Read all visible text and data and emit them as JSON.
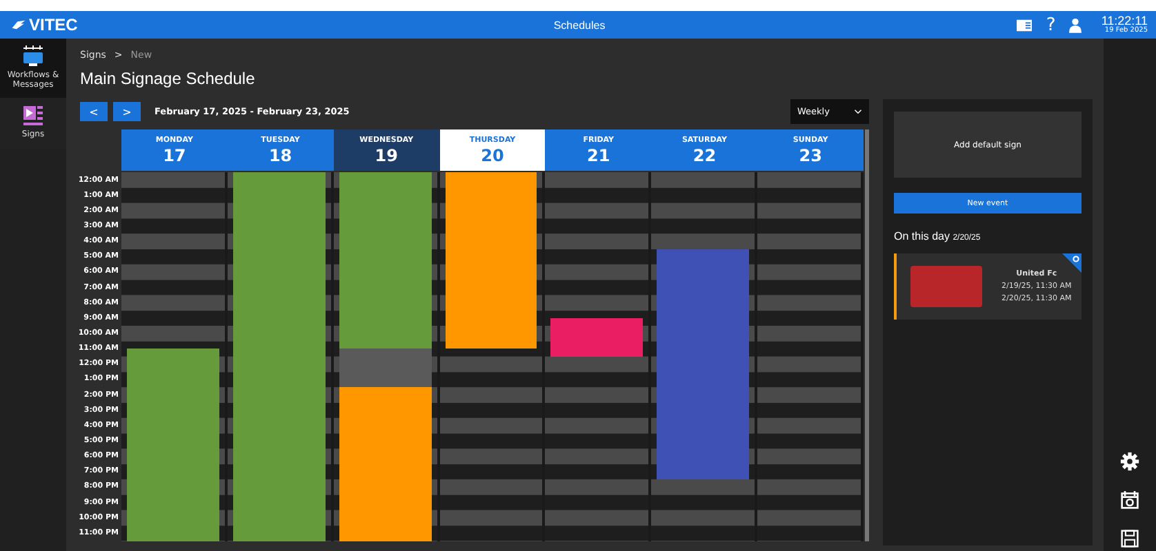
{
  "header": {
    "logo": "VITEC",
    "title": "Schedules",
    "time": "11:22:11",
    "date": "19 Feb 2025",
    "help": "?"
  },
  "nav": [
    {
      "label": "Workflows & Messages",
      "selected": true
    },
    {
      "label": "Signs",
      "selected": false
    }
  ],
  "breadcrumb": {
    "items": [
      "Signs",
      "New"
    ],
    "separator": ">"
  },
  "page_title": "Main Signage Schedule",
  "toolbar": {
    "prev": "<",
    "next": ">",
    "range": "February 17, 2025 - February 23, 2025",
    "view": "Weekly"
  },
  "hours": [
    "12:00 AM",
    "1:00 AM",
    "2:00 AM",
    "3:00 AM",
    "4:00 AM",
    "5:00 AM",
    "6:00 AM",
    "7:00 AM",
    "8:00 AM",
    "9:00 AM",
    "10:00 AM",
    "11:00 AM",
    "12:00 PM",
    "1:00 PM",
    "2:00 PM",
    "3:00 PM",
    "4:00 PM",
    "5:00 PM",
    "6:00 PM",
    "7:00 PM",
    "8:00 PM",
    "9:00 PM",
    "10:00 PM",
    "11:00 PM"
  ],
  "days": [
    {
      "name": "MONDAY",
      "date": "17",
      "selected": false,
      "today": false,
      "events": [
        {
          "color": "#659b3a"
        }
      ]
    },
    {
      "name": "TUESDAY",
      "date": "18",
      "selected": false,
      "today": false,
      "events": [
        {
          "color": "#659b3a"
        }
      ]
    },
    {
      "name": "WEDNESDAY",
      "date": "19",
      "selected": false,
      "today": true,
      "events": [
        {
          "color": "#659b3a"
        },
        {
          "color": "#5a5a5a"
        },
        {
          "color": "#ff9800"
        }
      ]
    },
    {
      "name": "THURSDAY",
      "date": "20",
      "selected": true,
      "today": false,
      "events": [
        {
          "color": "#ff9800"
        }
      ]
    },
    {
      "name": "FRIDAY",
      "date": "21",
      "selected": false,
      "today": false,
      "events": [
        {
          "color": "#e91e63"
        }
      ]
    },
    {
      "name": "SATURDAY",
      "date": "22",
      "selected": false,
      "today": false,
      "events": [
        {
          "color": "#3f51b5"
        }
      ]
    },
    {
      "name": "SUNDAY",
      "date": "23",
      "selected": false,
      "today": false
    }
  ],
  "side_panel": {
    "default_sign": "Add default sign",
    "new_event": "New event",
    "day_heading": "On this day",
    "day_date": "2/20/25",
    "events": [
      {
        "title": "United Fc",
        "start": "2/19/25, 11:30 AM",
        "end": "2/20/25, 11:30 AM",
        "color": "#f39c12"
      }
    ]
  }
}
